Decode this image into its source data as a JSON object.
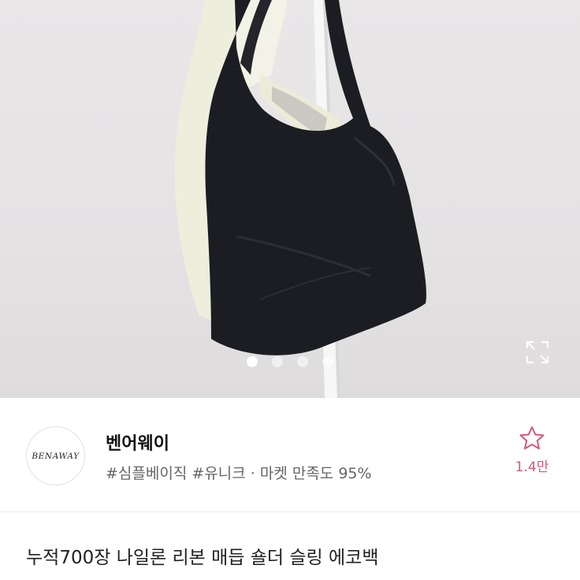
{
  "carousel": {
    "total_slides": 4,
    "active_slide": 1,
    "expand_icon": "expand-icon"
  },
  "seller": {
    "logo_text": "BENAWAY",
    "name": "벤어웨이",
    "meta": "#심플베이직 #유니크 · 마켓 만족도 95%",
    "favorite_icon": "star-outline-icon",
    "favorite_count": "1.4만"
  },
  "product": {
    "title": "누적700장 나일론 리본 매듭 숄더 슬링 에코백"
  },
  "colors": {
    "accent_pink": "#d4587a",
    "bag_black": "#1b1d22",
    "bag_cream": "#f1f0e2"
  }
}
